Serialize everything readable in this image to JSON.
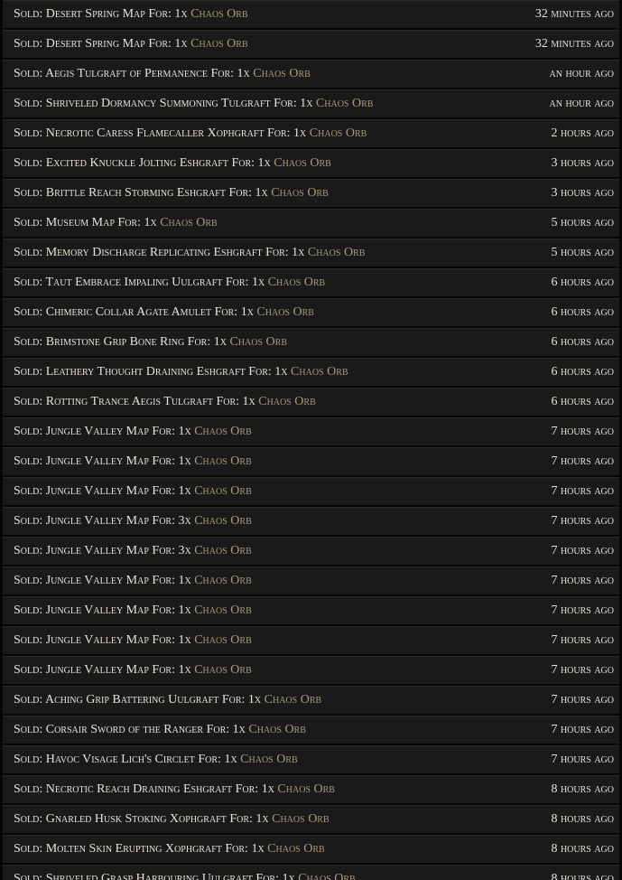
{
  "notifications": [
    {
      "text": "Sold: Desert Spring Map For: 1x ",
      "currency": "Chaos Orb",
      "time": "32 minutes ago"
    },
    {
      "text": "Sold: Desert Spring Map For: 1x ",
      "currency": "Chaos Orb",
      "time": "32 minutes ago"
    },
    {
      "text": "Sold: Aegis Tulgraft of Permanence For: 1x ",
      "currency": "Chaos Orb",
      "time": "an hour ago"
    },
    {
      "text": "Sold: Shriveled Dormancy Summoning Tulgraft For: 1x ",
      "currency": "Chaos Orb",
      "time": "an hour ago"
    },
    {
      "text": "Sold: Necrotic Caress Flamecaller Xophgraft For: 1x ",
      "currency": "Chaos Orb",
      "time": "2 hours ago"
    },
    {
      "text": "Sold: Excited Knuckle Jolting Eshgraft For: 1x ",
      "currency": "Chaos Orb",
      "time": "3 hours ago"
    },
    {
      "text": "Sold: Brittle Reach Storming Eshgraft For: 1x ",
      "currency": "Chaos Orb",
      "time": "3 hours ago"
    },
    {
      "text": "Sold: Museum Map For: 1x ",
      "currency": "Chaos Orb",
      "time": "5 hours ago"
    },
    {
      "text": "Sold: Memory Discharge Replicating Eshgraft For: 1x ",
      "currency": "Chaos Orb",
      "time": "5 hours ago"
    },
    {
      "text": "Sold: Taut Embrace Impaling Uulgraft For: 1x ",
      "currency": "Chaos Orb",
      "time": "6 hours ago"
    },
    {
      "text": "Sold: Chimeric Collar Agate Amulet For: 1x ",
      "currency": "Chaos Orb",
      "time": "6 hours ago"
    },
    {
      "text": "Sold: Brimstone Grip Bone Ring For: 1x ",
      "currency": "Chaos Orb",
      "time": "6 hours ago"
    },
    {
      "text": "Sold: Leathery Thought Draining Eshgraft For: 1x ",
      "currency": "Chaos Orb",
      "time": "6 hours ago"
    },
    {
      "text": "Sold: Rotting Trance Aegis Tulgraft For: 1x ",
      "currency": "Chaos Orb",
      "time": "6 hours ago"
    },
    {
      "text": "Sold: Jungle Valley Map For: 1x ",
      "currency": "Chaos Orb",
      "time": "7 hours ago"
    },
    {
      "text": "Sold: Jungle Valley Map For: 1x ",
      "currency": "Chaos Orb",
      "time": "7 hours ago"
    },
    {
      "text": "Sold: Jungle Valley Map For: 1x ",
      "currency": "Chaos Orb",
      "time": "7 hours ago"
    },
    {
      "text": "Sold: Jungle Valley Map For: 3x ",
      "currency": "Chaos Orb",
      "time": "7 hours ago"
    },
    {
      "text": "Sold: Jungle Valley Map For: 3x ",
      "currency": "Chaos Orb",
      "time": "7 hours ago"
    },
    {
      "text": "Sold: Jungle Valley Map For: 1x ",
      "currency": "Chaos Orb",
      "time": "7 hours ago"
    },
    {
      "text": "Sold: Jungle Valley Map For: 1x ",
      "currency": "Chaos Orb",
      "time": "7 hours ago"
    },
    {
      "text": "Sold: Jungle Valley Map For: 1x ",
      "currency": "Chaos Orb",
      "time": "7 hours ago"
    },
    {
      "text": "Sold: Jungle Valley Map For: 1x ",
      "currency": "Chaos Orb",
      "time": "7 hours ago"
    },
    {
      "text": "Sold: Aching Grip Battering Uulgraft For: 1x ",
      "currency": "Chaos Orb",
      "time": "7 hours ago"
    },
    {
      "text": "Sold: Corsair Sword of the Ranger For: 1x ",
      "currency": "Chaos Orb",
      "time": "7 hours ago"
    },
    {
      "text": "Sold: Havoc Visage Lich's Circlet For: 1x ",
      "currency": "Chaos Orb",
      "time": "7 hours ago"
    },
    {
      "text": "Sold: Necrotic Reach Draining Eshgraft For: 1x ",
      "currency": "Chaos Orb",
      "time": "8 hours ago"
    },
    {
      "text": "Sold: Gnarled Husk Stoking Xophgraft For: 1x ",
      "currency": "Chaos Orb",
      "time": "8 hours ago"
    },
    {
      "text": "Sold: Molten Skin Erupting Xophgraft For: 1x ",
      "currency": "Chaos Orb",
      "time": "8 hours ago"
    },
    {
      "text": "Sold: Shriveled Grasp Harbouring Uulgraft For: 1x ",
      "currency": "Chaos Orb",
      "time": "8 hours ago"
    }
  ],
  "colors": {
    "row_background": "#1a1a1b",
    "text": "#e8e2d6",
    "currency_text": "#a89a7c",
    "page_background": "#070707"
  }
}
